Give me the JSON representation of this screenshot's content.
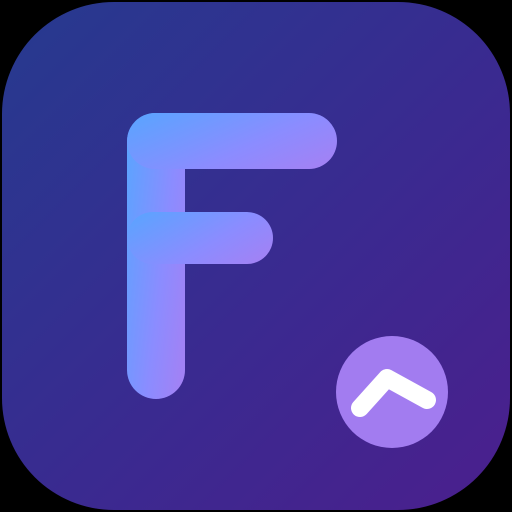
{
  "app_icon": {
    "background_gradient": [
      "#263A8F",
      "#3A2A90",
      "#4B1F8D"
    ],
    "letter_gradient": [
      "#5EA2FF",
      "#8B8CFF",
      "#A182F5"
    ],
    "badge_fill": "#A27CF0",
    "badge_chevron_color": "#FFFFFF",
    "letter_glyph_icon": "letter-f-icon",
    "badge_icon": "chevron-up-icon"
  }
}
